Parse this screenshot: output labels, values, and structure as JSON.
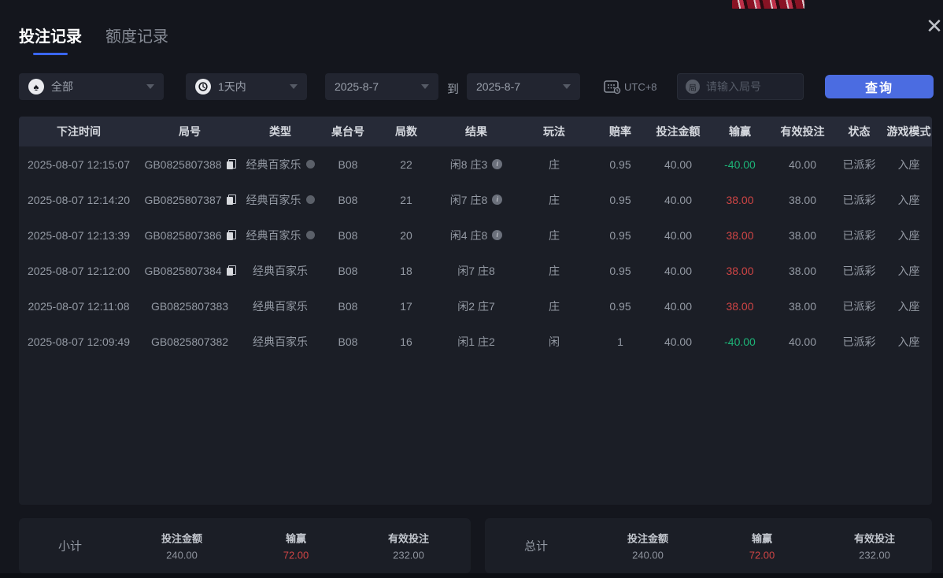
{
  "window": {
    "close_glyph": "✕"
  },
  "tabs": [
    {
      "label": "投注记录",
      "active": true
    },
    {
      "label": "额度记录",
      "active": false
    }
  ],
  "filters": {
    "game_type": {
      "value": "全部",
      "icon": "spade"
    },
    "time_range": {
      "value": "1天内",
      "icon": "clock"
    },
    "date_from": "2025-8-7",
    "to_label": "到",
    "date_to": "2025-8-7",
    "timezone": "UTC+8",
    "round_input": {
      "placeholder": "请输入局号",
      "icon": "round-badge"
    },
    "query_button": "查询"
  },
  "table": {
    "columns": [
      "下注时间",
      "局号",
      "类型",
      "桌台号",
      "局数",
      "结果",
      "玩法",
      "赔率",
      "投注金额",
      "输赢",
      "有效投注",
      "状态",
      "游戏模式"
    ],
    "rows": [
      {
        "time": "2025-08-07 12:15:07",
        "round_id": "GB0825807388",
        "copyable": true,
        "type": "经典百家乐",
        "type_badge": true,
        "table_no": "B08",
        "rounds": "22",
        "result": "闲8 庄3",
        "result_info": true,
        "play": "庄",
        "odds": "0.95",
        "bet": "40.00",
        "win": "-40.00",
        "valid": "40.00",
        "status": "已派彩",
        "mode": "入座"
      },
      {
        "time": "2025-08-07 12:14:20",
        "round_id": "GB0825807387",
        "copyable": true,
        "type": "经典百家乐",
        "type_badge": true,
        "table_no": "B08",
        "rounds": "21",
        "result": "闲7 庄8",
        "result_info": true,
        "play": "庄",
        "odds": "0.95",
        "bet": "40.00",
        "win": "38.00",
        "valid": "38.00",
        "status": "已派彩",
        "mode": "入座"
      },
      {
        "time": "2025-08-07 12:13:39",
        "round_id": "GB0825807386",
        "copyable": true,
        "type": "经典百家乐",
        "type_badge": true,
        "table_no": "B08",
        "rounds": "20",
        "result": "闲4 庄8",
        "result_info": true,
        "play": "庄",
        "odds": "0.95",
        "bet": "40.00",
        "win": "38.00",
        "valid": "38.00",
        "status": "已派彩",
        "mode": "入座"
      },
      {
        "time": "2025-08-07 12:12:00",
        "round_id": "GB0825807384",
        "copyable": true,
        "type": "经典百家乐",
        "type_badge": false,
        "table_no": "B08",
        "rounds": "18",
        "result": "闲7 庄8",
        "result_info": false,
        "play": "庄",
        "odds": "0.95",
        "bet": "40.00",
        "win": "38.00",
        "valid": "38.00",
        "status": "已派彩",
        "mode": "入座"
      },
      {
        "time": "2025-08-07 12:11:08",
        "round_id": "GB0825807383",
        "copyable": false,
        "type": "经典百家乐",
        "type_badge": false,
        "table_no": "B08",
        "rounds": "17",
        "result": "闲2 庄7",
        "result_info": false,
        "play": "庄",
        "odds": "0.95",
        "bet": "40.00",
        "win": "38.00",
        "valid": "38.00",
        "status": "已派彩",
        "mode": "入座"
      },
      {
        "time": "2025-08-07 12:09:49",
        "round_id": "GB0825807382",
        "copyable": false,
        "type": "经典百家乐",
        "type_badge": false,
        "table_no": "B08",
        "rounds": "16",
        "result": "闲1 庄2",
        "result_info": false,
        "play": "闲",
        "odds": "1",
        "bet": "40.00",
        "win": "-40.00",
        "valid": "40.00",
        "status": "已派彩",
        "mode": "入座"
      }
    ]
  },
  "footer": {
    "subtotal": {
      "label": "小计",
      "stats": [
        {
          "label": "投注金额",
          "value": "240.00"
        },
        {
          "label": "输赢",
          "value": "72.00"
        },
        {
          "label": "有效投注",
          "value": "232.00"
        }
      ]
    },
    "total": {
      "label": "总计",
      "stats": [
        {
          "label": "投注金额",
          "value": "240.00"
        },
        {
          "label": "输赢",
          "value": "72.00"
        },
        {
          "label": "有效投注",
          "value": "232.00"
        }
      ]
    }
  },
  "colors": {
    "accent_blue": "#4b6ce1",
    "win_red": "#cf4545",
    "loss_green": "#1db578"
  }
}
